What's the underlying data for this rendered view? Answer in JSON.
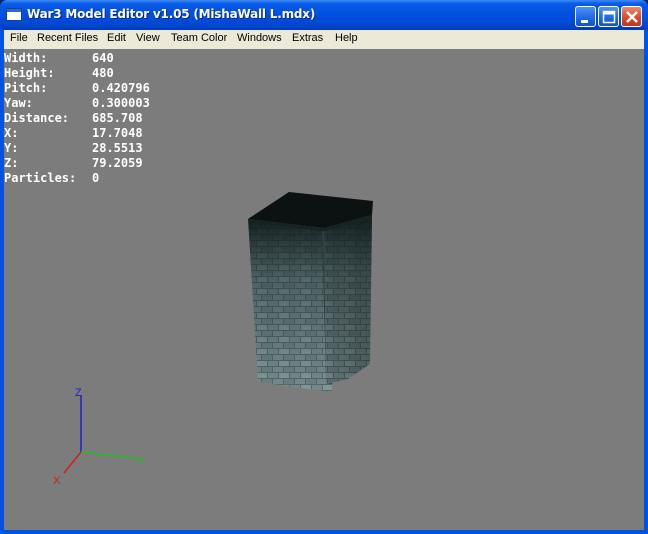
{
  "window": {
    "title": "War3 Model Editor v1.05 (MishaWall L.mdx)"
  },
  "menu": [
    "File",
    "Recent Files",
    "Edit",
    "View",
    "Team Color",
    "Windows",
    "Extras",
    "Help"
  ],
  "stats": [
    {
      "label": "Width:",
      "value": "640"
    },
    {
      "label": "Height:",
      "value": "480"
    },
    {
      "label": "Pitch:",
      "value": "0.420796"
    },
    {
      "label": "Yaw:",
      "value": "0.300003"
    },
    {
      "label": "Distance:",
      "value": "685.708"
    },
    {
      "label": "X:",
      "value": "17.7048"
    },
    {
      "label": "Y:",
      "value": "28.5513"
    },
    {
      "label": "Z:",
      "value": "79.2059"
    },
    {
      "label": "Particles:",
      "value": "0"
    }
  ],
  "axes": {
    "x": "X",
    "y": "Y",
    "z": "Z"
  },
  "colors": {
    "viewport": "#7c7c7c",
    "axis_x": "#cc2020",
    "axis_y": "#20c020",
    "axis_z": "#2020cc"
  },
  "icons": [
    "minimize-icon",
    "maximize-icon",
    "close-icon",
    "app-icon"
  ]
}
